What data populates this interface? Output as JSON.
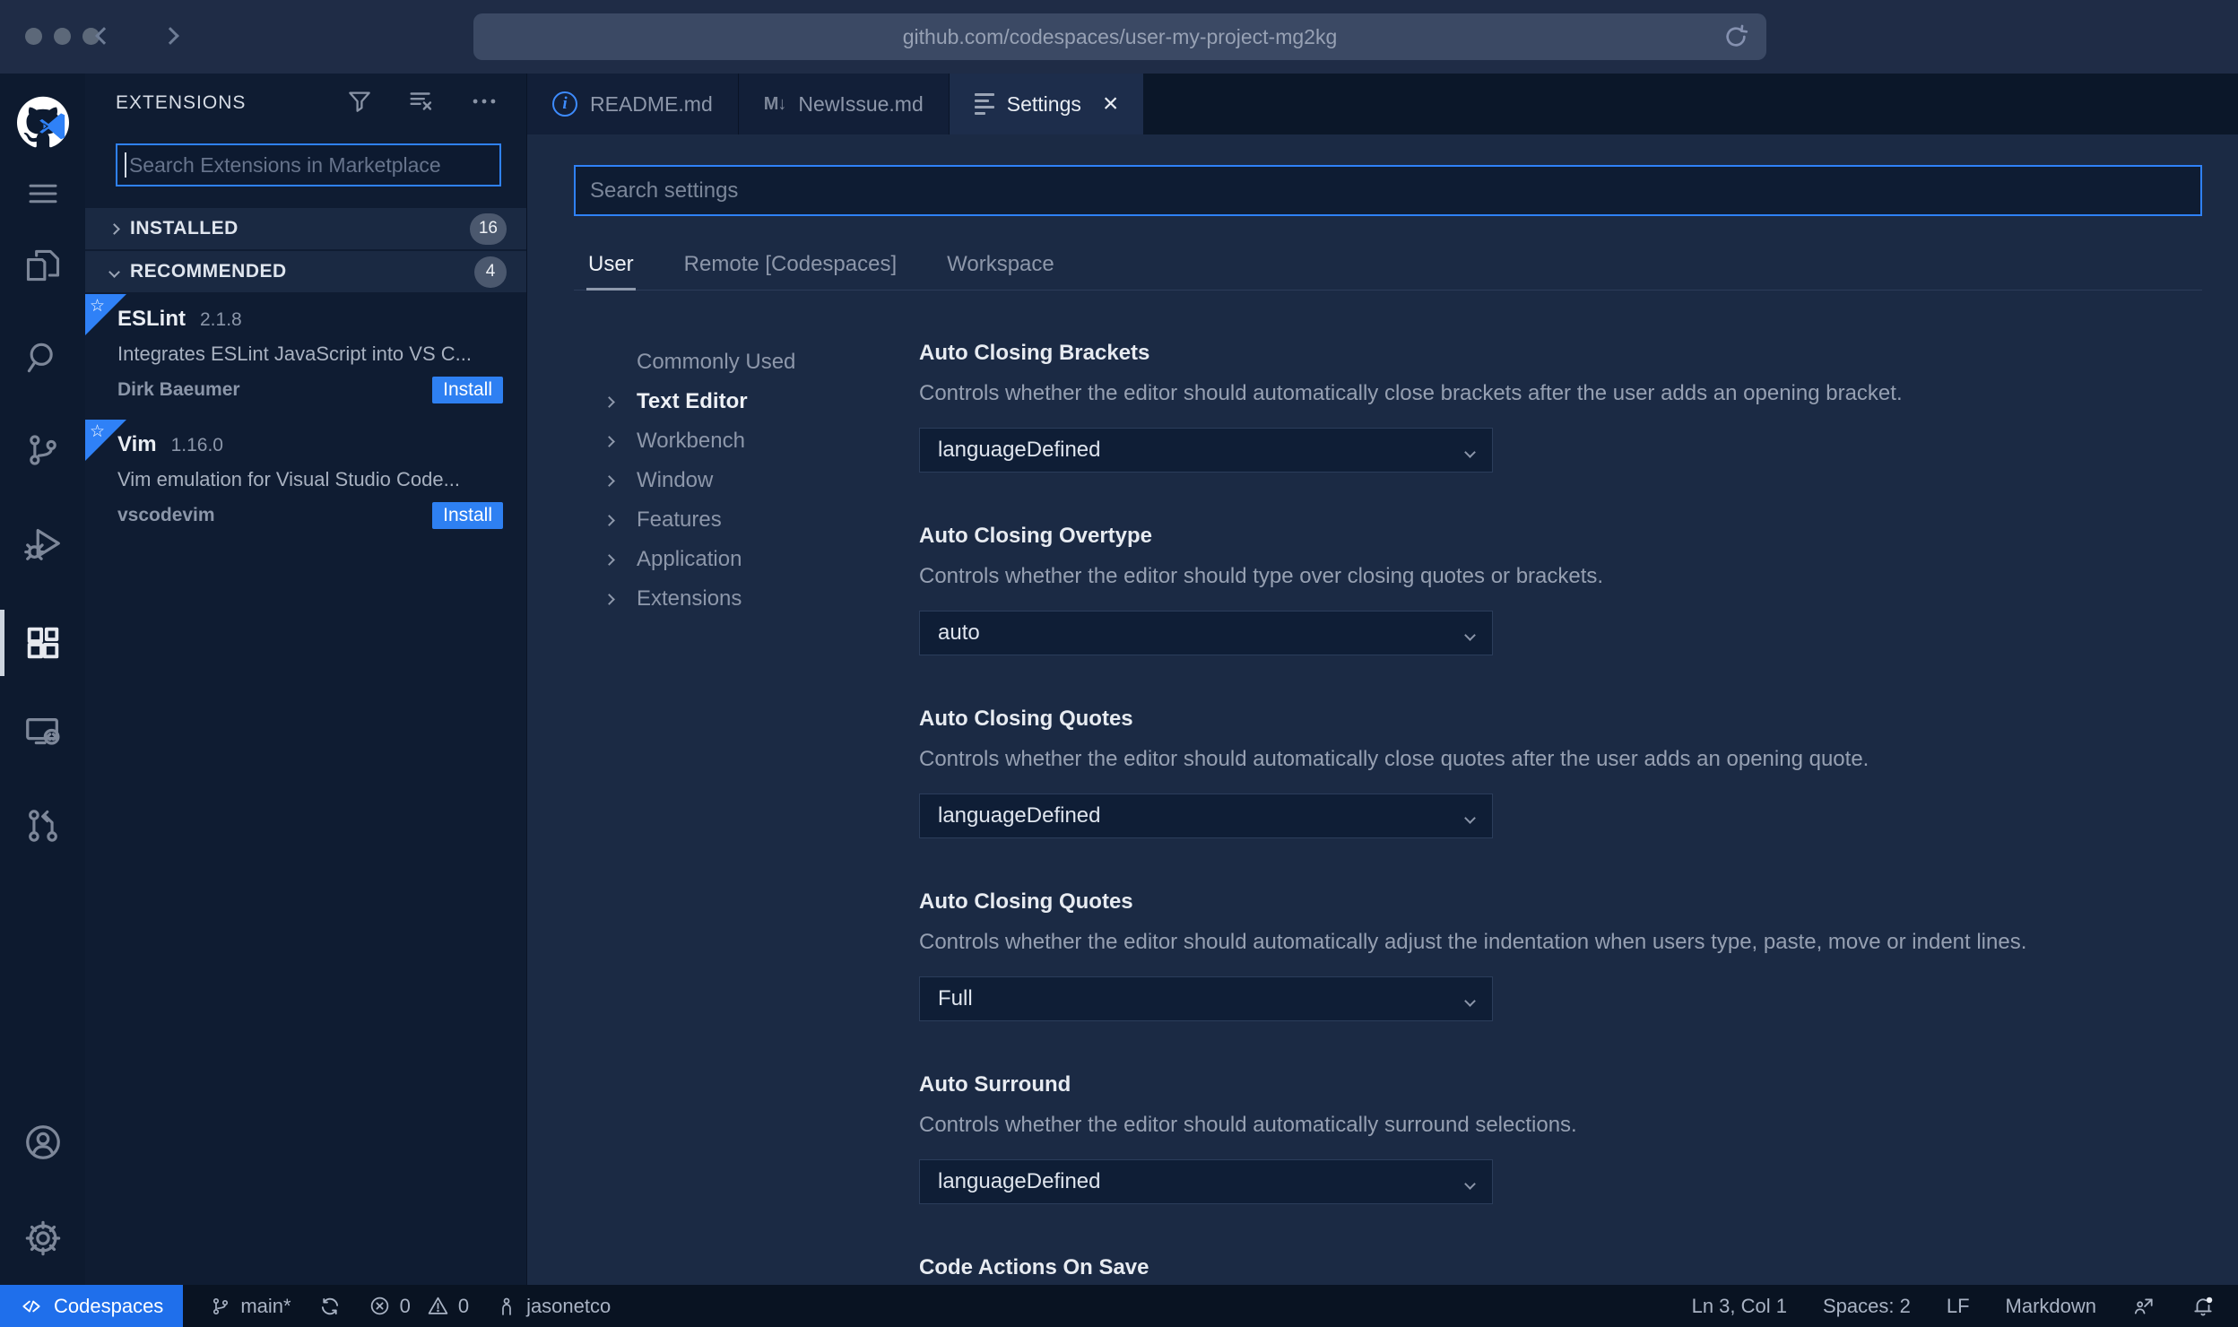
{
  "browser": {
    "url": "github.com/codespaces/user-my-project-mg2kg"
  },
  "sidebar": {
    "title": "EXTENSIONS",
    "search_placeholder": "Search Extensions in Marketplace",
    "sections": [
      {
        "label": "INSTALLED",
        "count": "16"
      },
      {
        "label": "RECOMMENDED",
        "count": "4"
      }
    ],
    "star_glyph": "☆",
    "extensions": [
      {
        "name": "ESLint",
        "version": "2.1.8",
        "description": "Integrates ESLint JavaScript into VS C...",
        "publisher": "Dirk Baeumer",
        "action": "Install"
      },
      {
        "name": "Vim",
        "version": "1.16.0",
        "description": "Vim emulation for Visual Studio Code...",
        "publisher": "vscodevim",
        "action": "Install"
      }
    ]
  },
  "tabs": [
    {
      "label": "README.md",
      "icon_text": "i"
    },
    {
      "label": "NewIssue.md",
      "icon_text": "M↓"
    },
    {
      "label": "Settings",
      "close_glyph": "×"
    }
  ],
  "settings": {
    "search_placeholder": "Search settings",
    "scopes": [
      {
        "label": "User"
      },
      {
        "label": "Remote [Codespaces]"
      },
      {
        "label": "Workspace"
      }
    ],
    "toc": [
      {
        "label": "Commonly Used"
      },
      {
        "label": "Text Editor"
      },
      {
        "label": "Workbench"
      },
      {
        "label": "Window"
      },
      {
        "label": "Features"
      },
      {
        "label": "Application"
      },
      {
        "label": "Extensions"
      }
    ],
    "items": [
      {
        "title": "Auto Closing Brackets",
        "description": "Controls whether the editor should automatically close brackets after the user adds an opening bracket.",
        "value": "languageDefined"
      },
      {
        "title": "Auto Closing Overtype",
        "description": "Controls whether the editor should type over closing quotes or brackets.",
        "value": "auto"
      },
      {
        "title": "Auto Closing Quotes",
        "description": "Controls whether the editor should automatically close quotes after the user adds an opening quote.",
        "value": "languageDefined"
      },
      {
        "title": "Auto Closing Quotes",
        "description": "Controls whether the editor should automatically adjust the indentation when users type, paste, move or indent lines.",
        "value": "Full"
      },
      {
        "title": "Auto Surround",
        "description": "Controls whether the editor should automatically surround selections.",
        "value": "languageDefined"
      },
      {
        "title": "Code Actions On Save"
      }
    ]
  },
  "status_bar": {
    "remote_label": "Codespaces",
    "branch": "main*",
    "errors": "0",
    "warnings": "0",
    "user": "jasonetco",
    "line_col": "Ln 3, Col 1",
    "spaces": "Spaces: 2",
    "eol": "LF",
    "language": "Markdown"
  },
  "colors": {
    "accent": "#2f81f7",
    "remote_bg": "#1f6feb",
    "install_bg": "#2e80f2"
  }
}
